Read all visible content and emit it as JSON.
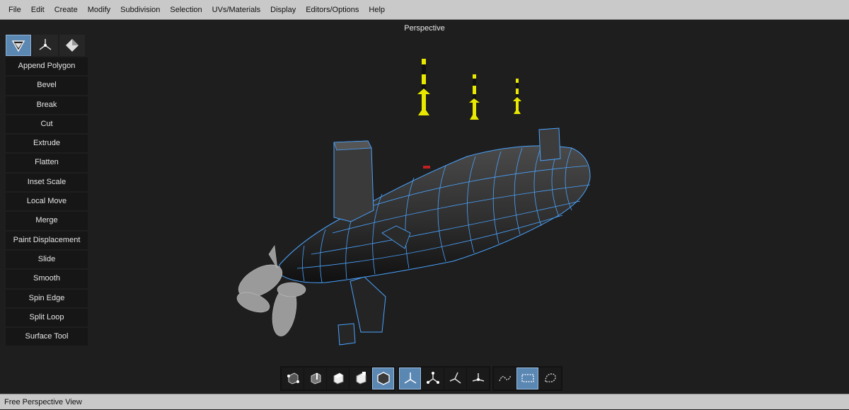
{
  "menu": [
    "File",
    "Edit",
    "Create",
    "Modify",
    "Subdivision",
    "Selection",
    "UVs/Materials",
    "Display",
    "Editors/Options",
    "Help"
  ],
  "viewport": {
    "title": "Perspective"
  },
  "mode_buttons": [
    {
      "icon": "face-mode-icon",
      "active": true
    },
    {
      "icon": "vertex-mode-icon",
      "active": false
    },
    {
      "icon": "object-mode-icon",
      "active": false
    }
  ],
  "tools": [
    "Append Polygon",
    "Bevel",
    "Break",
    "Cut",
    "Extrude",
    "Flatten",
    "Inset Scale",
    "Local Move",
    "Merge",
    "Paint Displacement",
    "Slide",
    "Smooth",
    "Spin Edge",
    "Split Loop",
    "Surface Tool"
  ],
  "bottom_toolbar": {
    "selection_groups": [
      {
        "icon": "vertex-select-icon",
        "active": false
      },
      {
        "icon": "edge-select-icon",
        "active": false
      },
      {
        "icon": "face-select-icon",
        "active": false
      },
      {
        "icon": "uv-select-icon",
        "active": false
      },
      {
        "icon": "object-select-icon",
        "active": true
      }
    ],
    "transform_groups": [
      {
        "icon": "world-axis-icon",
        "active": true
      },
      {
        "icon": "local-axis-icon",
        "active": false
      },
      {
        "icon": "normal-axis-icon",
        "active": false
      },
      {
        "icon": "screen-axis-icon",
        "active": false
      }
    ],
    "select_shapes": [
      {
        "icon": "lasso-select-icon",
        "active": false
      },
      {
        "icon": "rectangle-select-icon",
        "active": true
      },
      {
        "icon": "paint-select-icon",
        "active": false
      }
    ]
  },
  "status": {
    "text": "Free Perspective View"
  },
  "colors": {
    "accent": "#5b87b3",
    "wireframe": "#4aa3ff",
    "missile": "#e8e800",
    "menubar": "#c9c9c9"
  }
}
